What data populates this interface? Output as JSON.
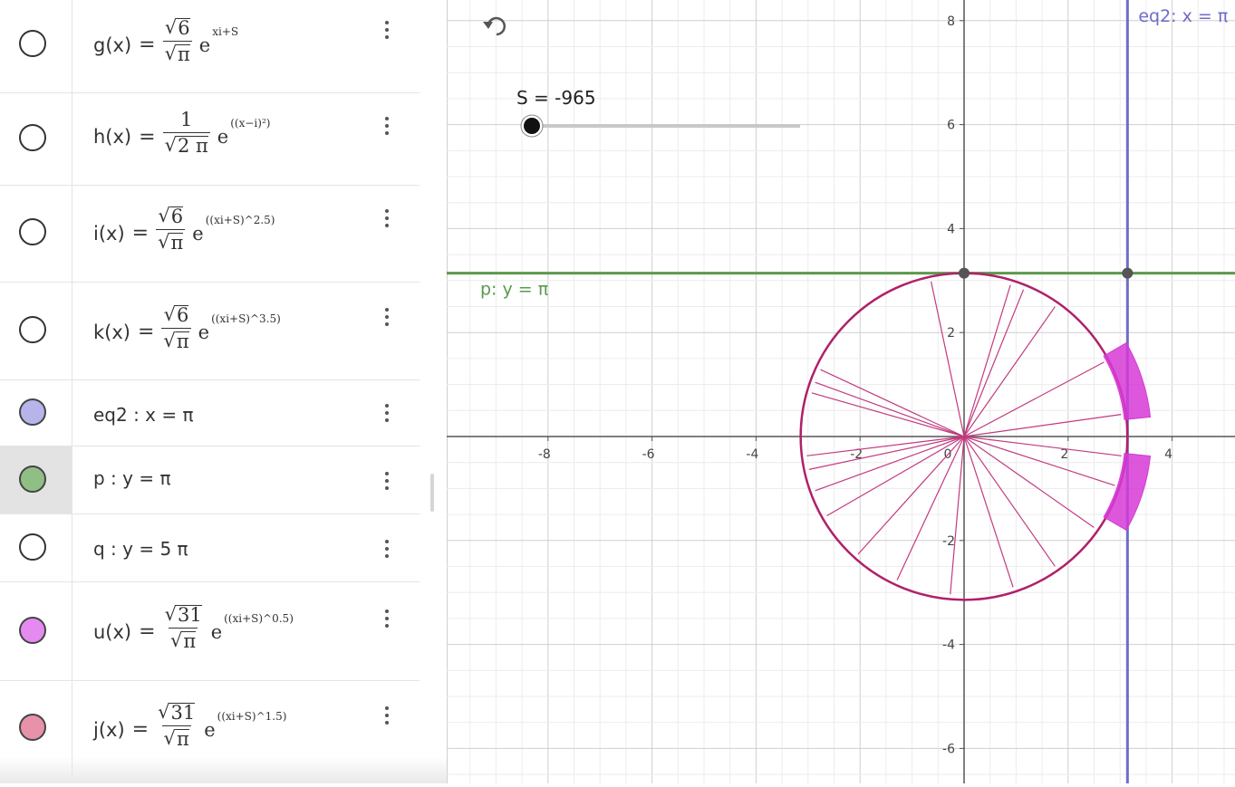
{
  "algebra": {
    "rows": [
      {
        "name": "g-row",
        "fn": "g(x)",
        "eq": "=",
        "num": "6",
        "den": "π",
        "num_sqrt": true,
        "den_sqrt": true,
        "base": "e",
        "exponent": "xi+S",
        "marble": "#ffffff",
        "marble_filled": false
      },
      {
        "name": "h-row",
        "fn": "h(x)",
        "eq": "=",
        "num": "1",
        "den": "2 π",
        "num_sqrt": false,
        "den_sqrt": true,
        "base": "e",
        "exponent": "((x−i)²)",
        "marble": "#ffffff",
        "marble_filled": false
      },
      {
        "name": "i-row",
        "fn": "i(x)",
        "eq": "=",
        "num": "6",
        "den": "π",
        "num_sqrt": true,
        "den_sqrt": true,
        "base": "e",
        "exponent": "((xi+S)^2.5)",
        "marble": "#ffffff",
        "marble_filled": false
      },
      {
        "name": "k-row",
        "fn": "k(x)",
        "eq": "=",
        "num": "6",
        "den": "π",
        "num_sqrt": true,
        "den_sqrt": true,
        "base": "e",
        "exponent": "((xi+S)^3.5)",
        "marble": "#ffffff",
        "marble_filled": false
      },
      {
        "name": "eq2-row",
        "text": "eq2 : x = π",
        "marble": "#b7b4ec",
        "marble_filled": true
      },
      {
        "name": "p-row",
        "text": "p : y = π",
        "marble": "#8fbf85",
        "marble_filled": true
      },
      {
        "name": "q-row",
        "text": "q : y = 5 π",
        "marble": "#ffffff",
        "marble_filled": false
      },
      {
        "name": "u-row",
        "fn": "u(x)",
        "eq": "=",
        "num": "31",
        "den": "π",
        "num_sqrt": true,
        "den_sqrt": true,
        "base": "e",
        "exponent": "((xi+S)^0.5)",
        "marble": "#e48af0",
        "marble_filled": true
      },
      {
        "name": "j-row",
        "fn": "j(x)",
        "eq": "=",
        "num": "31",
        "den": "π",
        "num_sqrt": true,
        "den_sqrt": true,
        "base": "e",
        "exponent": "((xi+S)^1.5)",
        "marble": "#e792a8",
        "marble_filled": true
      }
    ]
  },
  "graphics": {
    "undo_icon": "undo-icon",
    "slider_label": "S = -965",
    "slider_value": -965,
    "x_ticks": [
      "-8",
      "-6",
      "-4",
      "-2",
      "0",
      "2",
      "4"
    ],
    "y_ticks": [
      "8",
      "6",
      "4",
      "2",
      "-2",
      "-4",
      "-6"
    ],
    "line_p_label": "p: y = π",
    "line_eq2_label": "eq2: x = π",
    "colors": {
      "p_line": "#5a9a4c",
      "eq2_line": "#6f6cc9",
      "circle": "#b0206a",
      "fill": "#d63ad6"
    }
  }
}
